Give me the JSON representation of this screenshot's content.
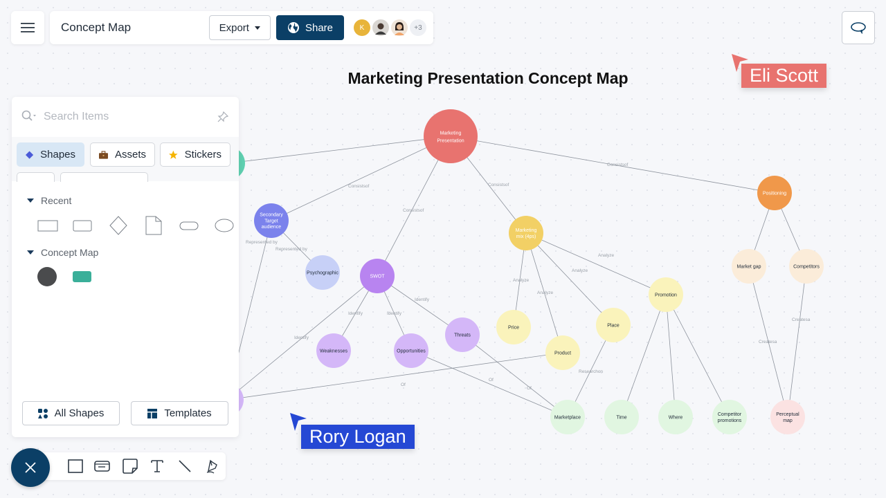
{
  "header": {
    "menu_icon": "hamburger-menu-icon",
    "doc_title": "Concept Map",
    "export_label": "Export",
    "share_label": "Share",
    "collaborators": [
      {
        "initial": "K",
        "color": "#e8b43a"
      },
      {
        "initial": "",
        "color": "#c9c3bd"
      },
      {
        "initial": "",
        "color": "#e6d3c2"
      }
    ],
    "more_collaborators": "+3"
  },
  "comment_icon": "comment-bubble-icon",
  "map_title": "Marketing Presentation Concept Map",
  "panel": {
    "search_placeholder": "Search Items",
    "tabs": [
      {
        "label": "Shapes",
        "icon": "diamond-icon",
        "active": true
      },
      {
        "label": "Assets",
        "icon": "briefcase-icon",
        "active": false
      },
      {
        "label": "Stickers",
        "icon": "star-icon",
        "active": false
      }
    ],
    "sections": [
      {
        "title": "Recent",
        "shapes": [
          "rectangle",
          "rounded-rectangle",
          "diamond",
          "document",
          "terminator",
          "ellipse"
        ]
      },
      {
        "title": "Concept Map",
        "shapes": [
          "dark-circle",
          "teal-rounded-rect"
        ]
      }
    ],
    "all_shapes_label": "All Shapes",
    "templates_label": "Templates"
  },
  "toolbar": {
    "tools": [
      "rectangle-tool",
      "card-tool",
      "sticky-note-tool",
      "text-tool",
      "line-tool",
      "pen-tool"
    ]
  },
  "concept_map": {
    "nodes": [
      {
        "id": "root",
        "label": "Marketing\nPresentation",
        "color": "#e8736f",
        "text": "#ffffff"
      },
      {
        "id": "teal",
        "label": "",
        "color": "#5fcfb0",
        "text": "#ffffff"
      },
      {
        "id": "secondary",
        "label": "Secondary\nTarget\naudience",
        "color": "#7b82ec",
        "text": "#ffffff"
      },
      {
        "id": "psycho",
        "label": "Psychographic",
        "color": "#c7d0f7",
        "text": "#1f2a37"
      },
      {
        "id": "swot",
        "label": "SWOT",
        "color": "#b884f0",
        "text": "#ffffff"
      },
      {
        "id": "weak",
        "label": "Weaknesses",
        "color": "#d4b7f8",
        "text": "#1f2a37"
      },
      {
        "id": "opp",
        "label": "Opportunities",
        "color": "#d4b7f8",
        "text": "#1f2a37"
      },
      {
        "id": "threats",
        "label": "Threats",
        "color": "#d4b7f8",
        "text": "#1f2a37"
      },
      {
        "id": "left-purple",
        "label": "",
        "color": "#d4b7f8",
        "text": "#1f2a37"
      },
      {
        "id": "mix",
        "label": "Marketing\nmix (4ps)",
        "color": "#f2d065",
        "text": "#ffffff"
      },
      {
        "id": "price",
        "label": "Price",
        "color": "#faf3bb",
        "text": "#1f2a37"
      },
      {
        "id": "product",
        "label": "Product",
        "color": "#faf3bb",
        "text": "#1f2a37"
      },
      {
        "id": "place",
        "label": "Place",
        "color": "#faf3bb",
        "text": "#1f2a37"
      },
      {
        "id": "promotion",
        "label": "Promotion",
        "color": "#faf3bb",
        "text": "#1f2a37"
      },
      {
        "id": "positioning",
        "label": "Positioning",
        "color": "#f0984a",
        "text": "#ffffff"
      },
      {
        "id": "gap",
        "label": "Market gap",
        "color": "#fbecd9",
        "text": "#1f2a37"
      },
      {
        "id": "competitors",
        "label": "Competitors",
        "color": "#fbecd9",
        "text": "#1f2a37"
      },
      {
        "id": "marketplace",
        "label": "Marketplace",
        "color": "#e1f6e1",
        "text": "#1f2a37"
      },
      {
        "id": "time",
        "label": "Time",
        "color": "#e1f6e1",
        "text": "#1f2a37"
      },
      {
        "id": "where",
        "label": "Where",
        "color": "#e1f6e1",
        "text": "#1f2a37"
      },
      {
        "id": "comp-promo",
        "label": "Competitor\npromotions",
        "color": "#e1f6e1",
        "text": "#1f2a37"
      },
      {
        "id": "perceptual",
        "label": "Perceptual\nmap",
        "color": "#fbe2e2",
        "text": "#1f2a37"
      }
    ],
    "edges": [
      {
        "from": "root",
        "to": "teal",
        "label": ""
      },
      {
        "from": "root",
        "to": "secondary",
        "label": "Consistsof"
      },
      {
        "from": "root",
        "to": "swot",
        "label": "Consistsof"
      },
      {
        "from": "root",
        "to": "mix",
        "label": "Consistsof"
      },
      {
        "from": "root",
        "to": "positioning",
        "label": "Consistsof"
      },
      {
        "from": "secondary",
        "to": "psycho",
        "label": "Represented by"
      },
      {
        "from": "secondary",
        "to": "left-purple",
        "label": "Represented by"
      },
      {
        "from": "swot",
        "to": "weak",
        "label": "Identify"
      },
      {
        "from": "swot",
        "to": "opp",
        "label": "Identify"
      },
      {
        "from": "swot",
        "to": "threats",
        "label": "Identify"
      },
      {
        "from": "swot",
        "to": "left-purple",
        "label": "Identify"
      },
      {
        "from": "mix",
        "to": "price",
        "label": "Analyze"
      },
      {
        "from": "mix",
        "to": "product",
        "label": "Analyze"
      },
      {
        "from": "mix",
        "to": "place",
        "label": "Analyze"
      },
      {
        "from": "mix",
        "to": "promotion",
        "label": "Analyze"
      },
      {
        "from": "positioning",
        "to": "gap",
        "label": ""
      },
      {
        "from": "positioning",
        "to": "competitors",
        "label": ""
      },
      {
        "from": "gap",
        "to": "perceptual",
        "label": "Createsa"
      },
      {
        "from": "competitors",
        "to": "perceptual",
        "label": "Createsa"
      },
      {
        "from": "opp",
        "to": "marketplace",
        "label": "Of"
      },
      {
        "from": "threats",
        "to": "marketplace",
        "label": "Of"
      },
      {
        "from": "left-purple",
        "to": "product",
        "label": "Of"
      },
      {
        "from": "place",
        "to": "marketplace",
        "label": "Researchon"
      },
      {
        "from": "promotion",
        "to": "time",
        "label": ""
      },
      {
        "from": "promotion",
        "to": "where",
        "label": ""
      },
      {
        "from": "promotion",
        "to": "comp-promo",
        "label": ""
      }
    ]
  },
  "cursors": [
    {
      "name": "Eli Scott",
      "color": "#e8736f"
    },
    {
      "name": "Rory Logan",
      "color": "#2548d4"
    }
  ]
}
